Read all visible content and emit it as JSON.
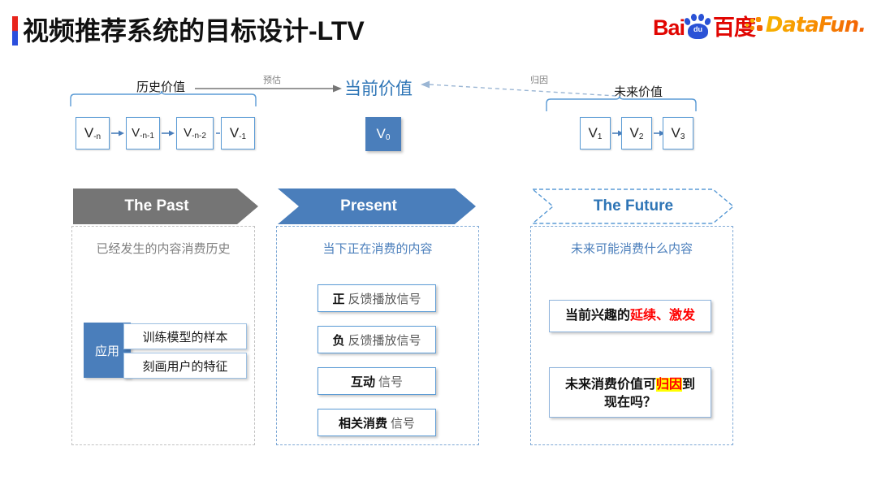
{
  "header": {
    "title": "视频推荐系统的目标设计-LTV",
    "baidu_bai": "Bai",
    "baidu_du": "du",
    "baidu_cn": "百度",
    "datafun": "DataFun."
  },
  "timeline": {
    "past_label": "历史价值",
    "estimate_label": "预估",
    "current_label": "当前价值",
    "attribution_label": "归因",
    "future_label": "未来价值",
    "past_boxes": [
      "V-n",
      "V-n-1",
      "V-n-2",
      "V-1"
    ],
    "current_box": "V0",
    "future_boxes": [
      "V1",
      "V2",
      "V3"
    ]
  },
  "columns": {
    "past": {
      "chevron": "The Past",
      "head": "已经发生的内容消费历史",
      "apply_tag": "应用",
      "apply_items": [
        "训练模型的样本",
        "刻画用户的特征"
      ]
    },
    "present": {
      "chevron": "Present",
      "head": "当下正在消费的内容",
      "signals": [
        {
          "strong": "正",
          "weak": "反馈播放信号"
        },
        {
          "strong": "负",
          "weak": "反馈播放信号"
        },
        {
          "strong": "互动",
          "weak": "信号"
        },
        {
          "strong": "相关消费",
          "weak": "信号"
        }
      ]
    },
    "future": {
      "chevron": "The Future",
      "head": "未来可能消费什么内容",
      "box1_pre": "当前兴趣的",
      "box1_red": "延续、激发",
      "box2_pre": "未来消费价值可",
      "box2_red": "归因",
      "box2_post": "到",
      "box2_line2": "现在吗？"
    }
  },
  "colors": {
    "accent_blue": "#4a7ebb",
    "light_blue": "#5b9bd5",
    "title_blue": "#2e75b6",
    "gray": "#757575",
    "red": "#ff0000",
    "highlight": "#ffff00",
    "baidu_red": "#e10602",
    "baidu_blue": "#2a52d6"
  }
}
